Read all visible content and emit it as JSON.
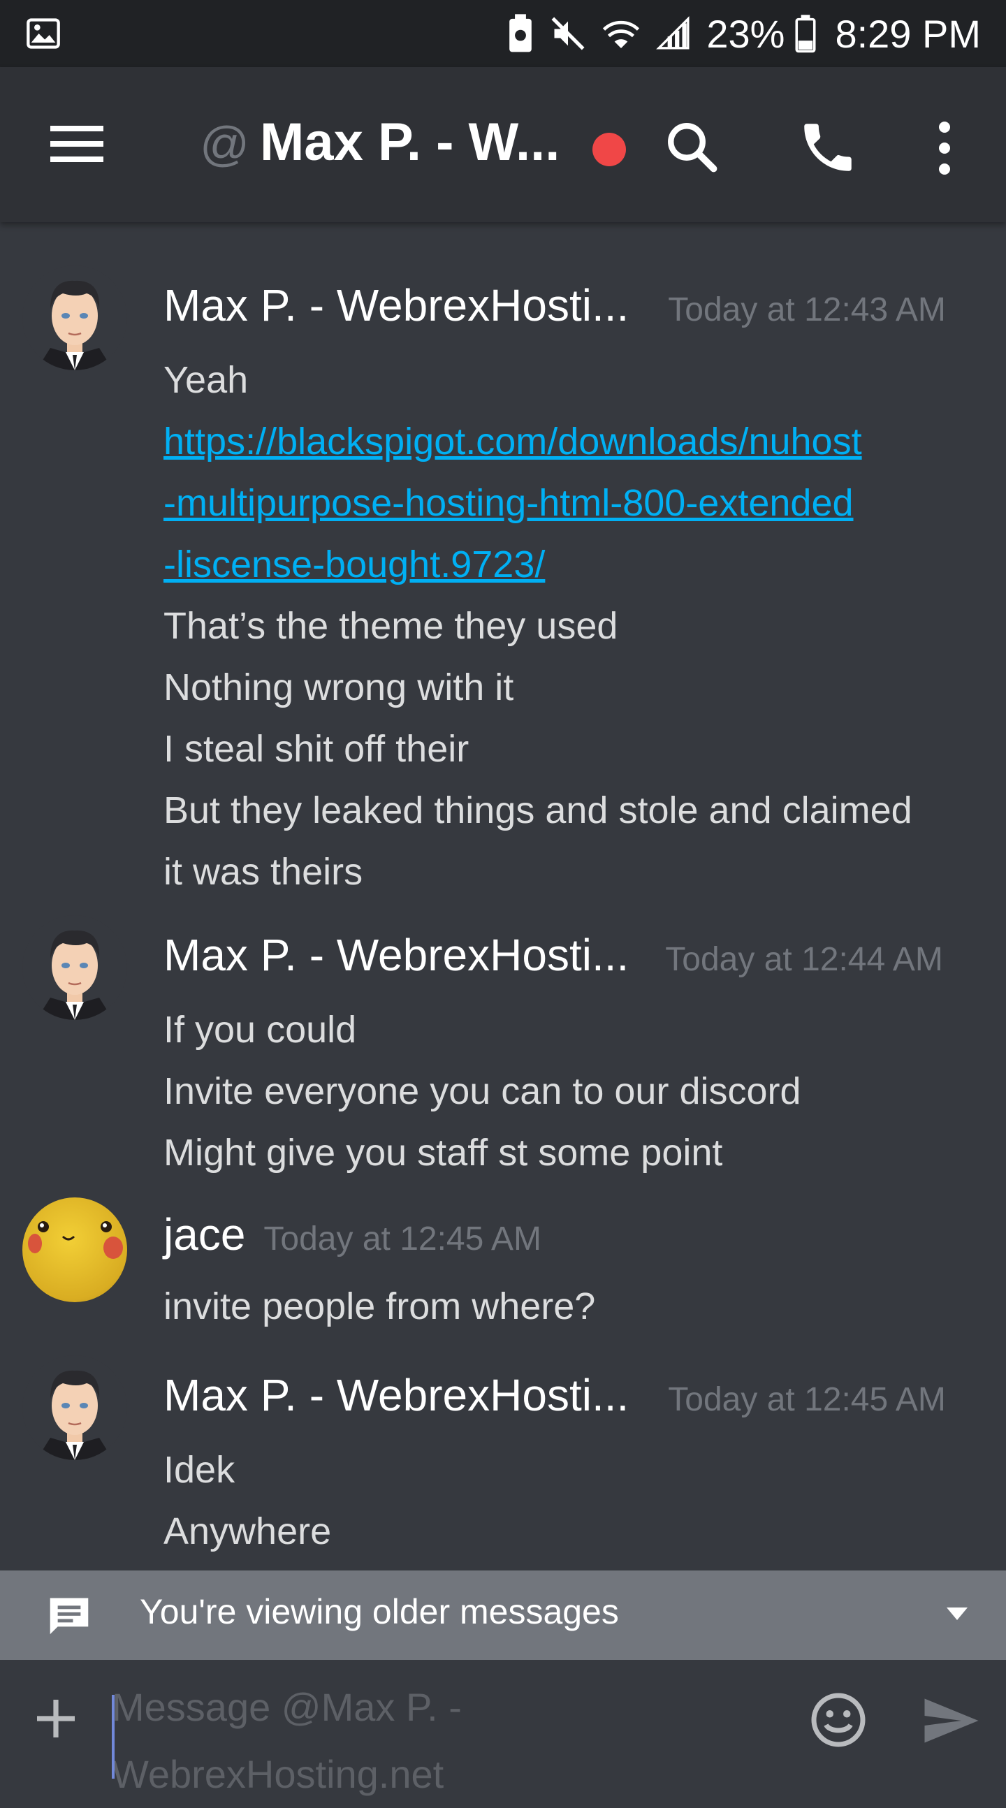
{
  "status_bar": {
    "battery_percent": "23%",
    "time": "8:29 PM",
    "icons": [
      "gallery-notification-icon",
      "battery-saver-icon",
      "mute-icon",
      "wifi-icon",
      "signal-icon",
      "battery-icon"
    ]
  },
  "app_bar": {
    "at_symbol": "@",
    "title": "Max P. - W...",
    "status_color": "#f04747",
    "icons": [
      "menu-icon",
      "search-icon",
      "phone-icon",
      "more-vert-icon"
    ]
  },
  "messages": [
    {
      "author": "Max P. - WebrexHosti...",
      "timestamp": "Today at 12:43 AM",
      "avatar": "cartoon-man-avatar",
      "lines": [
        {
          "text": "Yeah",
          "link": false
        },
        {
          "text": "https://blackspigot.com/downloads/nuhost",
          "link": true
        },
        {
          "text": "-multipurpose-hosting-html-800-extended",
          "link": true
        },
        {
          "text": "-liscense-bought.9723/",
          "link": true
        },
        {
          "text": "That’s the theme they used",
          "link": false
        },
        {
          "text": "Nothing wrong with it",
          "link": false
        },
        {
          "text": "I steal shit off their",
          "link": false
        },
        {
          "text": "But they leaked things and stole and claimed",
          "link": false
        },
        {
          "text": "it was theirs",
          "link": false
        }
      ]
    },
    {
      "author": "Max P. - WebrexHosti...",
      "timestamp": "Today at 12:44 AM",
      "avatar": "cartoon-man-avatar",
      "lines": [
        {
          "text": "If you could",
          "link": false
        },
        {
          "text": "Invite everyone you can to our discord",
          "link": false
        },
        {
          "text": "Might give you staff st some point",
          "link": false
        }
      ]
    },
    {
      "author": "jace",
      "timestamp": "Today at 12:45 AM",
      "avatar": "pikachu-avatar",
      "lines": [
        {
          "text": "invite people from where?",
          "link": false
        }
      ]
    },
    {
      "author": "Max P. - WebrexHosti...",
      "timestamp": "Today at 12:45 AM",
      "avatar": "cartoon-man-avatar",
      "lines": [
        {
          "text": "Idek",
          "link": false
        },
        {
          "text": "Anywhere",
          "link": false
        }
      ]
    }
  ],
  "older_messages_bar": {
    "text": "You're viewing older messages",
    "background": "#72767d"
  },
  "composer": {
    "placeholder_line1": "Message @Max P. -",
    "placeholder_line2": "WebrexHosting.net",
    "accent": "#7289da"
  },
  "colors": {
    "background": "#36393f",
    "app_bar": "#2f3136",
    "status_bar": "#202225",
    "link": "#00b0f4"
  }
}
